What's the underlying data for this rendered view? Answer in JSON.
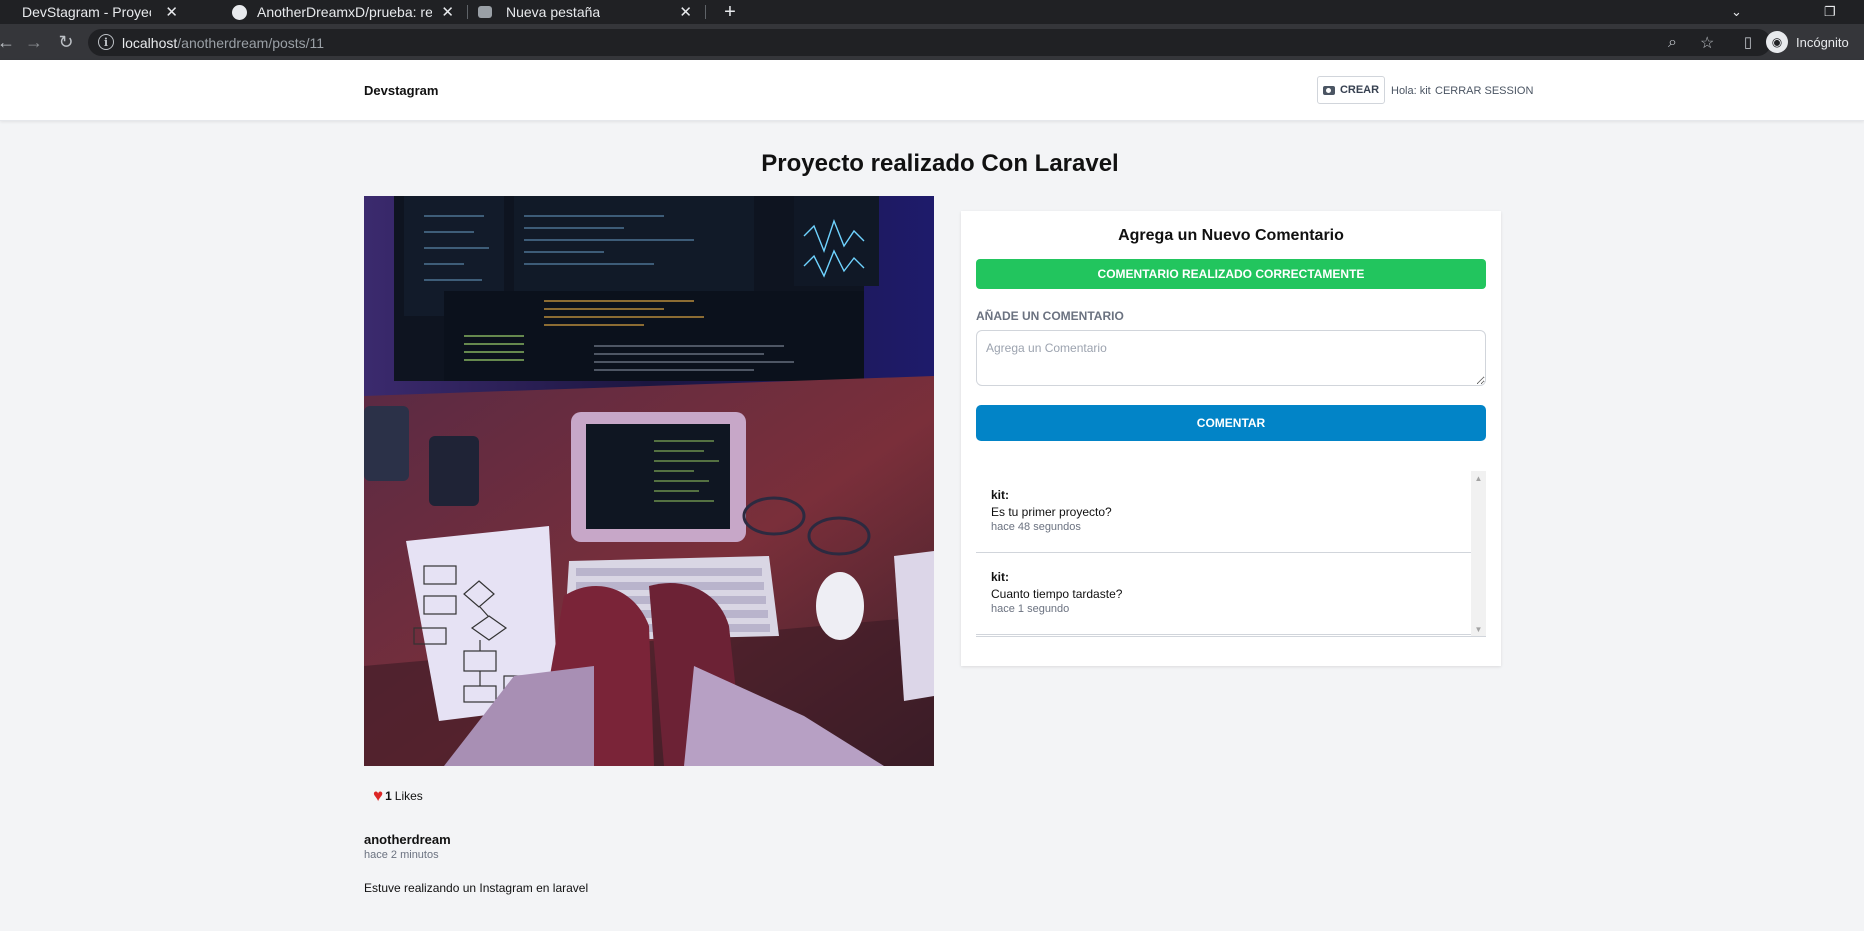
{
  "browser": {
    "tabs": [
      {
        "title": "DevStagram - Proyecto realizado",
        "active": true
      },
      {
        "title": "AnotherDreamxD/prueba: reposi",
        "active": false
      },
      {
        "title": "Nueva pestaña",
        "active": false
      }
    ],
    "url_host": "localhost",
    "url_path": "/anotherdream/posts/11",
    "profile_label": "Incógnito"
  },
  "header": {
    "brand": "Devstagram",
    "create_label": "CREAR",
    "greeting": "Hola: kit",
    "logout_label": "CERRAR SESSION"
  },
  "post": {
    "title": "Proyecto realizado Con Laravel",
    "likes_count": "1",
    "likes_label": "Likes",
    "author": "anotherdream",
    "time_ago": "hace 2 minutos",
    "description": "Estuve realizando un Instagram en laravel"
  },
  "comment_form": {
    "heading": "Agrega un Nuevo Comentario",
    "success_message": "COMENTARIO REALIZADO CORRECTAMENTE",
    "field_label": "AÑADE UN COMENTARIO",
    "placeholder": "Agrega un Comentario",
    "submit_label": "COMENTAR"
  },
  "comments": [
    {
      "author": "kit:",
      "text": "Es tu primer proyecto?",
      "time": "hace 48 segundos"
    },
    {
      "author": "kit:",
      "text": "Cuanto tiempo tardaste?",
      "time": "hace 1 segundo"
    }
  ],
  "colors": {
    "success": "#22c55e",
    "primary": "#0284c7",
    "like": "#dc2626"
  }
}
